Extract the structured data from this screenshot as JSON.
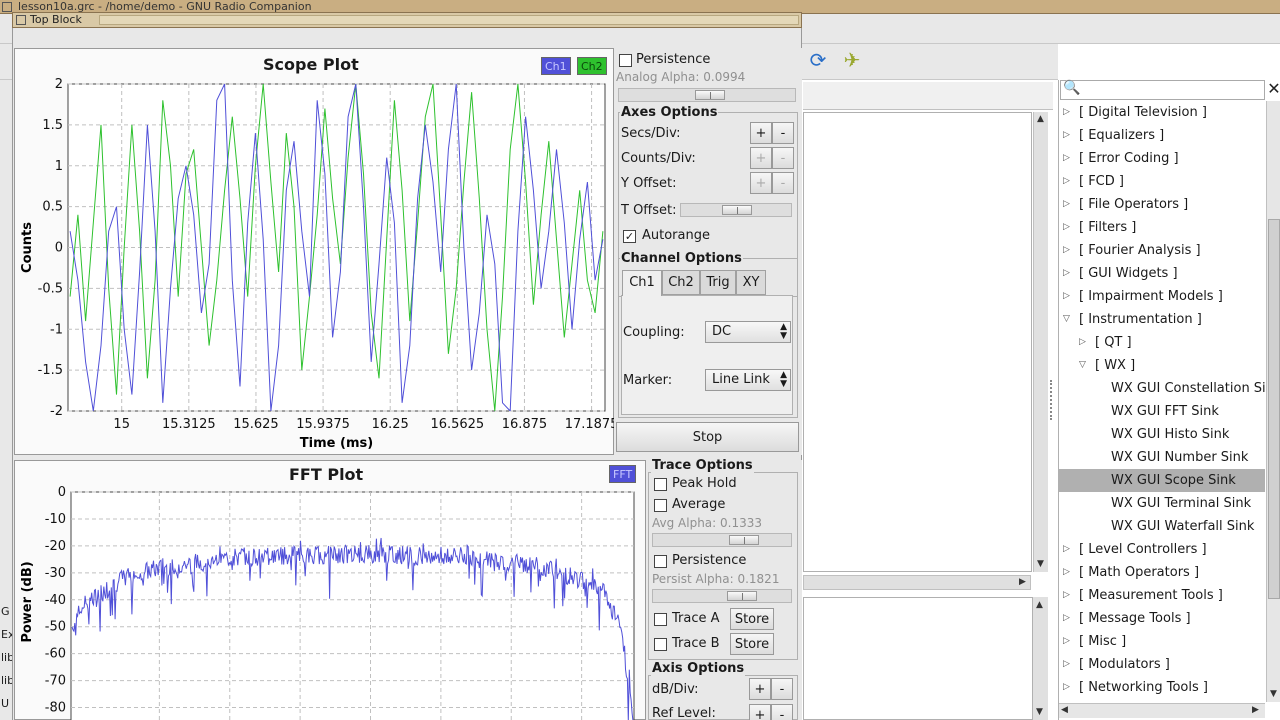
{
  "grc": {
    "window_title": "lesson10a.grc - /home/demo - GNU Radio Companion",
    "toolbar_icons": [
      "refresh-icon",
      "kill-icon"
    ],
    "console_snippets": [
      "G",
      "Ex",
      "lib",
      "lib",
      "U"
    ]
  },
  "top_block": {
    "title": "Top Block"
  },
  "scope": {
    "title": "Scope Plot",
    "legend": [
      {
        "label": "Ch1",
        "color": "#5050d8"
      },
      {
        "label": "Ch2",
        "color": "#2ec12e"
      }
    ],
    "persistence_label": "Persistence",
    "persistence_checked": false,
    "analog_alpha_label": "Analog Alpha: 0.0994",
    "axes_title": "Axes Options",
    "secs_div_label": "Secs/Div:",
    "counts_div_label": "Counts/Div:",
    "y_offset_label": "Y Offset:",
    "t_offset_label": "T Offset:",
    "autorange_label": "Autorange",
    "autorange_checked": true,
    "plus": "+",
    "minus": "-",
    "channel_title": "Channel Options",
    "tabs": [
      "Ch1",
      "Ch2",
      "Trig",
      "XY"
    ],
    "coupling_label": "Coupling:",
    "coupling_value": "DC",
    "marker_label": "Marker:",
    "marker_value": "Line Link",
    "stop_label": "Stop"
  },
  "fft": {
    "title": "FFT Plot",
    "legend": [
      {
        "label": "FFT",
        "color": "#5050d8"
      }
    ],
    "trace_title": "Trace Options",
    "peak_hold_label": "Peak Hold",
    "average_label": "Average",
    "avg_alpha_label": "Avg Alpha: 0.1333",
    "persistence_label": "Persistence",
    "persist_alpha_label": "Persist Alpha: 0.1821",
    "trace_a_label": "Trace A",
    "trace_b_label": "Trace B",
    "store_label": "Store",
    "axis_title": "Axis Options",
    "db_div_label": "dB/Div:",
    "ref_level_label": "Ref Level:",
    "plus": "+",
    "minus": "-"
  },
  "block_tree": {
    "close_icon": "close-icon",
    "search_icon": "search-icon",
    "items": [
      {
        "label": "[ Digital Television ]",
        "level": 0,
        "expanded": false
      },
      {
        "label": "[ Equalizers ]",
        "level": 0,
        "expanded": false
      },
      {
        "label": "[ Error Coding ]",
        "level": 0,
        "expanded": false
      },
      {
        "label": "[ FCD ]",
        "level": 0,
        "expanded": false
      },
      {
        "label": "[ File Operators ]",
        "level": 0,
        "expanded": false
      },
      {
        "label": "[ Filters ]",
        "level": 0,
        "expanded": false
      },
      {
        "label": "[ Fourier Analysis ]",
        "level": 0,
        "expanded": false
      },
      {
        "label": "[ GUI Widgets ]",
        "level": 0,
        "expanded": false
      },
      {
        "label": "[ Impairment Models ]",
        "level": 0,
        "expanded": false
      },
      {
        "label": "[ Instrumentation ]",
        "level": 0,
        "expanded": true
      },
      {
        "label": "[ QT ]",
        "level": 1,
        "expanded": false
      },
      {
        "label": "[ WX ]",
        "level": 1,
        "expanded": true
      },
      {
        "label": "WX GUI Constellation Si",
        "level": 2,
        "leaf": true
      },
      {
        "label": "WX GUI FFT Sink",
        "level": 2,
        "leaf": true
      },
      {
        "label": "WX GUI Histo Sink",
        "level": 2,
        "leaf": true
      },
      {
        "label": "WX GUI Number Sink",
        "level": 2,
        "leaf": true
      },
      {
        "label": "WX GUI Scope Sink",
        "level": 2,
        "leaf": true,
        "selected": true
      },
      {
        "label": "WX GUI Terminal Sink",
        "level": 2,
        "leaf": true
      },
      {
        "label": "WX GUI Waterfall Sink",
        "level": 2,
        "leaf": true
      },
      {
        "label": "[ Level Controllers ]",
        "level": 0,
        "expanded": false
      },
      {
        "label": "[ Math Operators ]",
        "level": 0,
        "expanded": false
      },
      {
        "label": "[ Measurement Tools ]",
        "level": 0,
        "expanded": false
      },
      {
        "label": "[ Message Tools ]",
        "level": 0,
        "expanded": false
      },
      {
        "label": "[ Misc ]",
        "level": 0,
        "expanded": false
      },
      {
        "label": "[ Modulators ]",
        "level": 0,
        "expanded": false
      },
      {
        "label": "[ Networking Tools ]",
        "level": 0,
        "expanded": false
      }
    ]
  },
  "chart_data": [
    {
      "type": "line",
      "title": "Scope Plot",
      "xlabel": "Time (ms)",
      "ylabel": "Counts",
      "xlim": [
        14.75,
        17.25
      ],
      "ylim": [
        -2,
        2
      ],
      "x_ticks": [
        "15",
        "15.3125",
        "15.625",
        "15.9375",
        "16.25",
        "16.5625",
        "16.875",
        "17.1875"
      ],
      "x_tick_values": [
        15,
        15.3125,
        15.625,
        15.9375,
        16.25,
        16.5625,
        16.875,
        17.1875
      ],
      "y_ticks": [
        "2",
        "1.5",
        "1",
        "0.5",
        "0",
        "-0.5",
        "-1",
        "-1.5",
        "-2"
      ],
      "y_tick_values": [
        2,
        1.5,
        1,
        0.5,
        0,
        -0.5,
        -1,
        -1.5,
        -2
      ],
      "grid": true,
      "legend": "top-right",
      "series": [
        {
          "name": "Ch1",
          "color": "#5050d8",
          "x_start": 14.76,
          "x_end": 17.24,
          "values": [
            0.2,
            -0.4,
            -1.4,
            -2.0,
            -1.2,
            0.2,
            0.5,
            -1.0,
            -1.8,
            -0.3,
            1.5,
            0.2,
            -1.9,
            -0.5,
            0.6,
            1.0,
            0.4,
            -0.8,
            -0.2,
            1.8,
            2.0,
            -0.4,
            -1.7,
            0.3,
            1.4,
            0.1,
            -2.0,
            -1.2,
            0.7,
            1.3,
            0.2,
            -0.6,
            1.8,
            0.9,
            -1.1,
            -0.3,
            1.6,
            2.0,
            0.5,
            -1.4,
            -0.2,
            1.1,
            0.3,
            -1.9,
            -1.2,
            0.6,
            1.5,
            0.8,
            -0.3,
            1.2,
            2.0,
            0.0,
            -1.5,
            -0.8,
            0.4,
            -0.2,
            -1.9,
            -2.0,
            0.2,
            1.6,
            0.7,
            -0.5,
            0.2,
            1.2,
            0.3,
            -1.0,
            0.1,
            0.8,
            -0.4,
            0.1
          ]
        },
        {
          "name": "Ch2",
          "color": "#2ec12e",
          "x_start": 14.76,
          "x_end": 17.24,
          "values": [
            -0.6,
            0.4,
            -0.9,
            0.3,
            1.5,
            -0.5,
            -1.8,
            0.0,
            1.5,
            0.2,
            -1.6,
            -0.4,
            1.8,
            1.0,
            -0.6,
            0.9,
            1.2,
            0.0,
            -1.2,
            -0.4,
            0.7,
            1.6,
            0.6,
            -0.6,
            1.0,
            2.0,
            0.8,
            -0.3,
            1.4,
            0.5,
            -1.5,
            -0.6,
            0.4,
            1.7,
            0.6,
            -0.2,
            1.1,
            2.0,
            0.9,
            -0.8,
            -1.6,
            0.1,
            1.8,
            0.7,
            -0.9,
            0.3,
            1.6,
            2.0,
            0.4,
            -1.3,
            -0.5,
            0.8,
            1.9,
            0.6,
            -1.0,
            -2.0,
            -0.6,
            1.2,
            2.0,
            0.8,
            -0.7,
            0.4,
            1.3,
            0.1,
            -1.1,
            -0.2,
            0.7,
            -0.4,
            -0.8,
            0.2
          ]
        }
      ]
    },
    {
      "type": "line",
      "title": "FFT Plot",
      "xlabel": "",
      "ylabel": "Power (dB)",
      "ylim": [
        -85,
        0
      ],
      "y_ticks": [
        "0",
        "-10",
        "-20",
        "-30",
        "-40",
        "-50",
        "-60",
        "-70",
        "-80"
      ],
      "y_tick_values": [
        0,
        -10,
        -20,
        -30,
        -40,
        -50,
        -60,
        -70,
        -80
      ],
      "grid": true,
      "legend": "top-right",
      "series": [
        {
          "name": "FFT",
          "color": "#5050d8",
          "envelope": [
            [
              0.0,
              -50
            ],
            [
              0.02,
              -42
            ],
            [
              0.06,
              -36
            ],
            [
              0.1,
              -31
            ],
            [
              0.16,
              -28
            ],
            [
              0.3,
              -24
            ],
            [
              0.5,
              -23
            ],
            [
              0.7,
              -24
            ],
            [
              0.84,
              -28
            ],
            [
              0.9,
              -32
            ],
            [
              0.95,
              -38
            ],
            [
              0.98,
              -52
            ],
            [
              1.0,
              -85
            ]
          ],
          "points": 600
        }
      ]
    }
  ]
}
